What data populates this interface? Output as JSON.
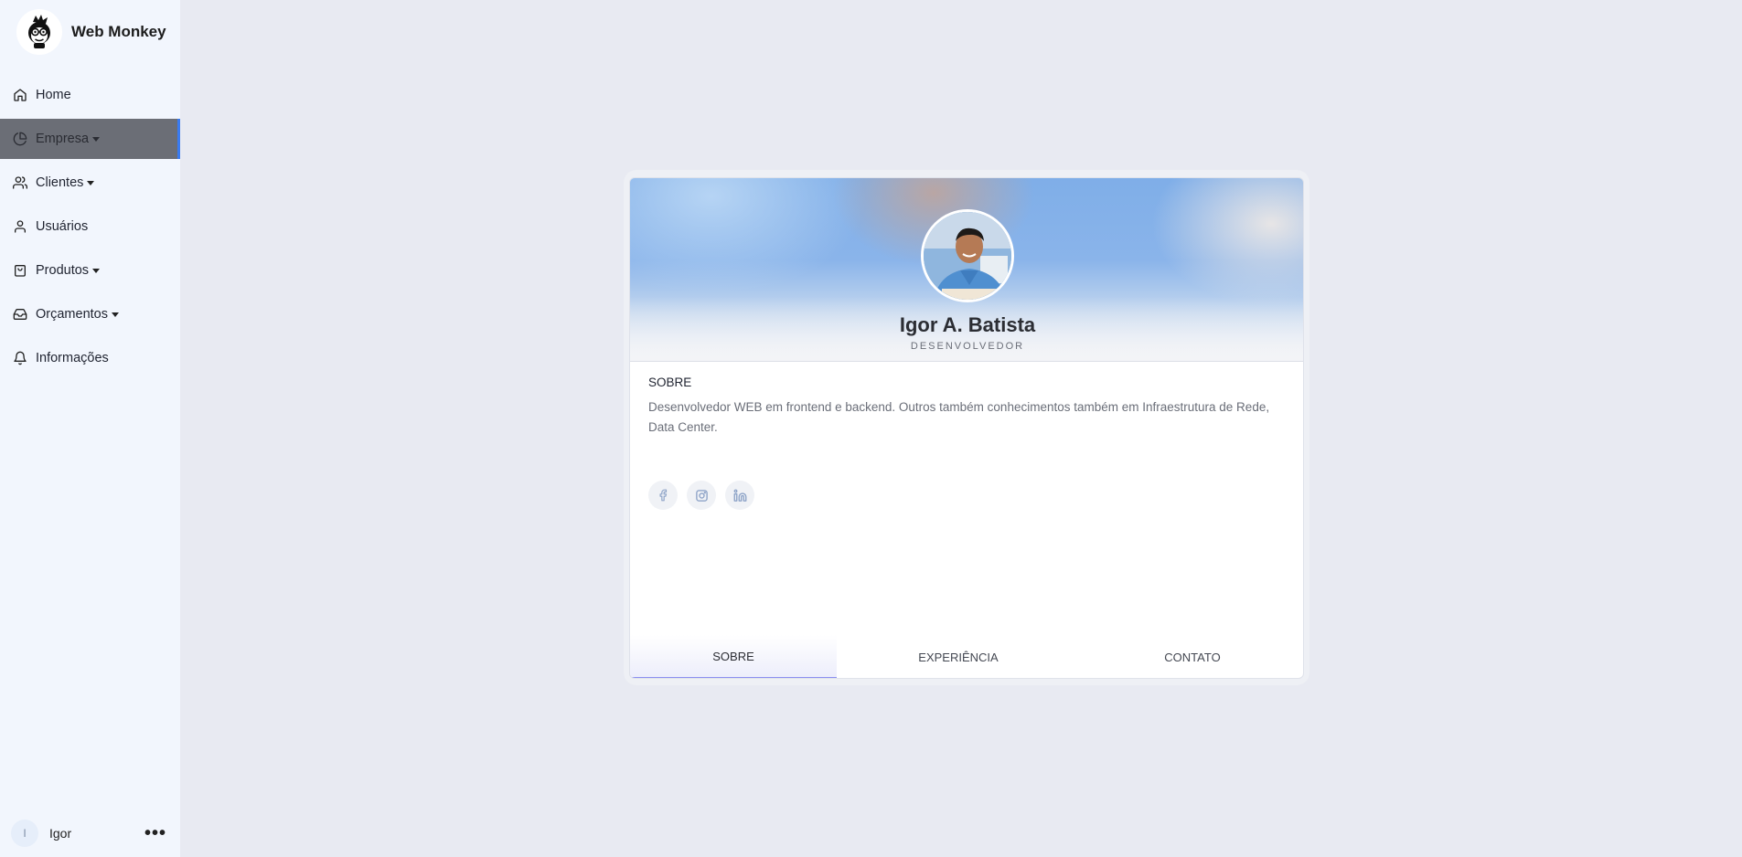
{
  "brand": {
    "name": "Web Monkey"
  },
  "sidebar": {
    "items": [
      {
        "label": "Home",
        "icon": "home-icon",
        "has_caret": false,
        "active": false
      },
      {
        "label": "Empresa",
        "icon": "pie-chart-icon",
        "has_caret": true,
        "active": true
      },
      {
        "label": "Clientes",
        "icon": "users-icon",
        "has_caret": true,
        "active": false
      },
      {
        "label": "Usuários",
        "icon": "user-icon",
        "has_caret": false,
        "active": false
      },
      {
        "label": "Produtos",
        "icon": "shopping-bag-icon",
        "has_caret": true,
        "active": false
      },
      {
        "label": "Orçamentos",
        "icon": "inbox-icon",
        "has_caret": true,
        "active": false
      },
      {
        "label": "Informações",
        "icon": "bell-icon",
        "has_caret": false,
        "active": false
      }
    ],
    "accent_color": "#3a7bf0"
  },
  "user": {
    "initial": "I",
    "name": "Igor",
    "more_icon": "more-horizontal-icon"
  },
  "profile": {
    "name": "Igor A. Batista",
    "role": "DESENVOLVEDOR",
    "section_title": "SOBRE",
    "about": "Desenvolvedor WEB em frontend e backend. Outros também conhecimentos também em Infraestrutura de Rede, Data Center.",
    "socials": [
      "facebook-icon",
      "instagram-icon",
      "linkedin-icon"
    ]
  },
  "tabs": [
    {
      "label": "SOBRE",
      "active": true
    },
    {
      "label": "EXPERIÊNCIA",
      "active": false
    },
    {
      "label": "CONTATO",
      "active": false
    }
  ]
}
